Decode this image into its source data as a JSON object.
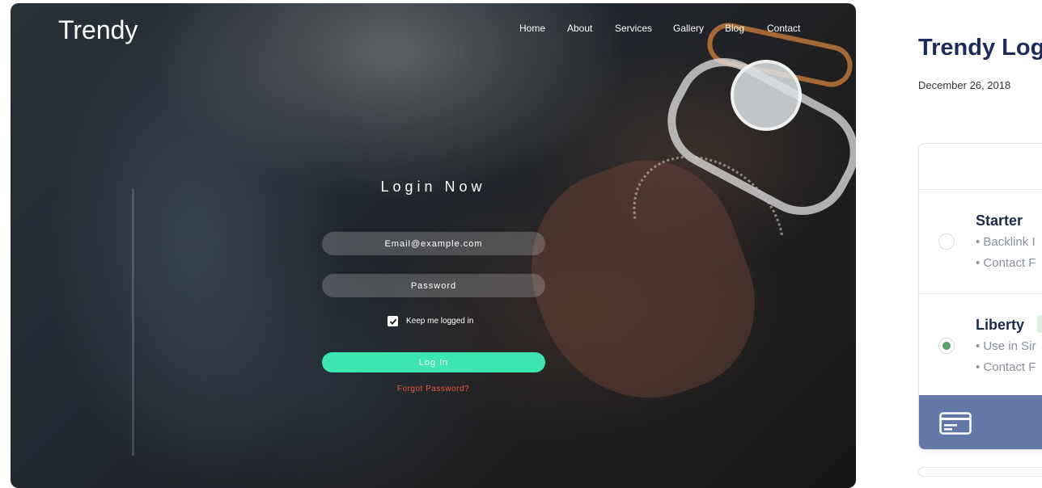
{
  "preview": {
    "logo": "Trendy",
    "nav": [
      {
        "label": "Home"
      },
      {
        "label": "About"
      },
      {
        "label": "Services"
      },
      {
        "label": "Gallery"
      },
      {
        "label": "Blog"
      },
      {
        "label": "Contact"
      }
    ],
    "login_title": "Login Now",
    "email_placeholder": "Email@example.com",
    "password_placeholder": "Password",
    "keep_logged_in": "Keep me logged in",
    "keep_logged_in_checked": true,
    "login_button": "Log In",
    "forgot_password": "Forgot Password?",
    "colors": {
      "button": "#3de6b0",
      "forgot": "#e95c3e"
    }
  },
  "product": {
    "title": "Trendy Log",
    "date": "December 26, 2018",
    "options": [
      {
        "name": "Starter",
        "selected": false,
        "features": [
          "• Backlink I",
          "• Contact F"
        ]
      },
      {
        "name": "Liberty",
        "selected": true,
        "features": [
          "• Use in Sir",
          "• Contact F"
        ]
      }
    ],
    "footer_icon": "credit-card-icon",
    "colors": {
      "title": "#1c2b5a",
      "footer": "#6378a6",
      "selected_radio": "#5aa26a"
    }
  }
}
